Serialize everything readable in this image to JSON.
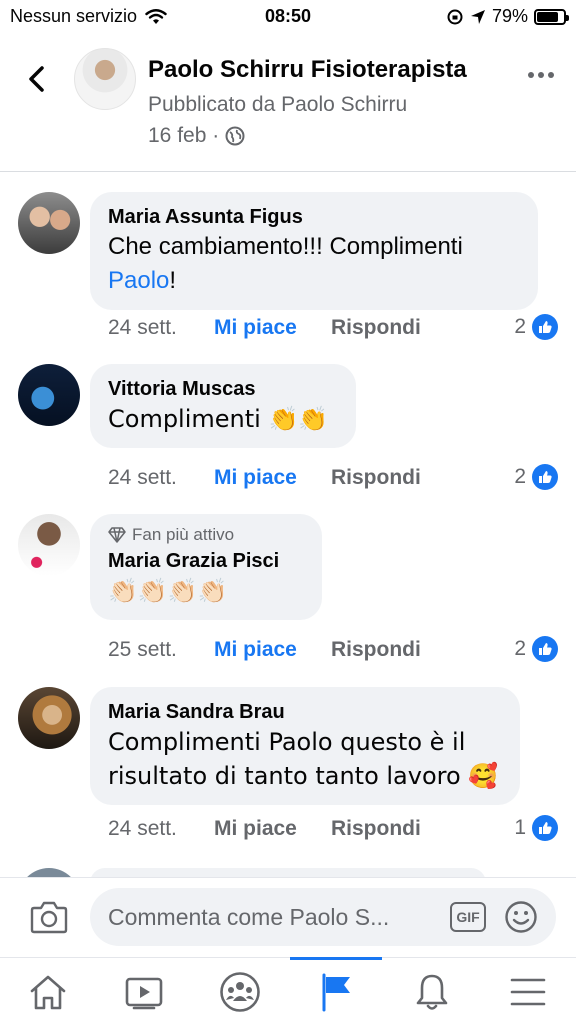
{
  "status_bar": {
    "carrier": "Nessun servizio",
    "time": "08:50",
    "battery": "79%",
    "battery_level": 0.79
  },
  "header": {
    "page_name": "Paolo Schirru Fisioterapista",
    "published_by": "Pubblicato da Paolo Schirru",
    "date": "16 feb ·"
  },
  "comments": [
    {
      "author": "Maria Assunta Figus",
      "text_before": "Che cambiamento!!! Complimenti ",
      "mention": "Paolo",
      "text_after": "!",
      "time": "24 sett.",
      "like_label": "Mi piace",
      "reply_label": "Rispondi",
      "reactions": "2"
    },
    {
      "author": "Vittoria Muscas",
      "text": "Complimenti 👏👏",
      "time": "24 sett.",
      "like_label": "Mi piace",
      "reply_label": "Rispondi",
      "reactions": "2"
    },
    {
      "badge": "Fan più attivo",
      "author": "Maria Grazia Pisci",
      "text": "👏🏻👏🏻👏🏻👏🏻",
      "time": "25 sett.",
      "like_label": "Mi piace",
      "reply_label": "Rispondi",
      "reactions": "2"
    },
    {
      "author": "Maria Sandra Brau",
      "text": "Complimenti Paolo questo è il risultato di tanto tanto lavoro 🥰",
      "time": "24 sett.",
      "like_label": "Mi piace",
      "reply_label": "Rispondi",
      "reactions": "1"
    }
  ],
  "composer": {
    "placeholder": "Commenta come Paolo S...",
    "gif_label": "GIF"
  },
  "bottom_nav": [
    "home-icon",
    "video-icon",
    "groups-icon",
    "pages-flag-icon",
    "notifications-bell-icon",
    "menu-icon"
  ],
  "colors": {
    "accent": "#1877f2",
    "bubble": "#f0f2f5",
    "secondary_text": "#65676b"
  }
}
